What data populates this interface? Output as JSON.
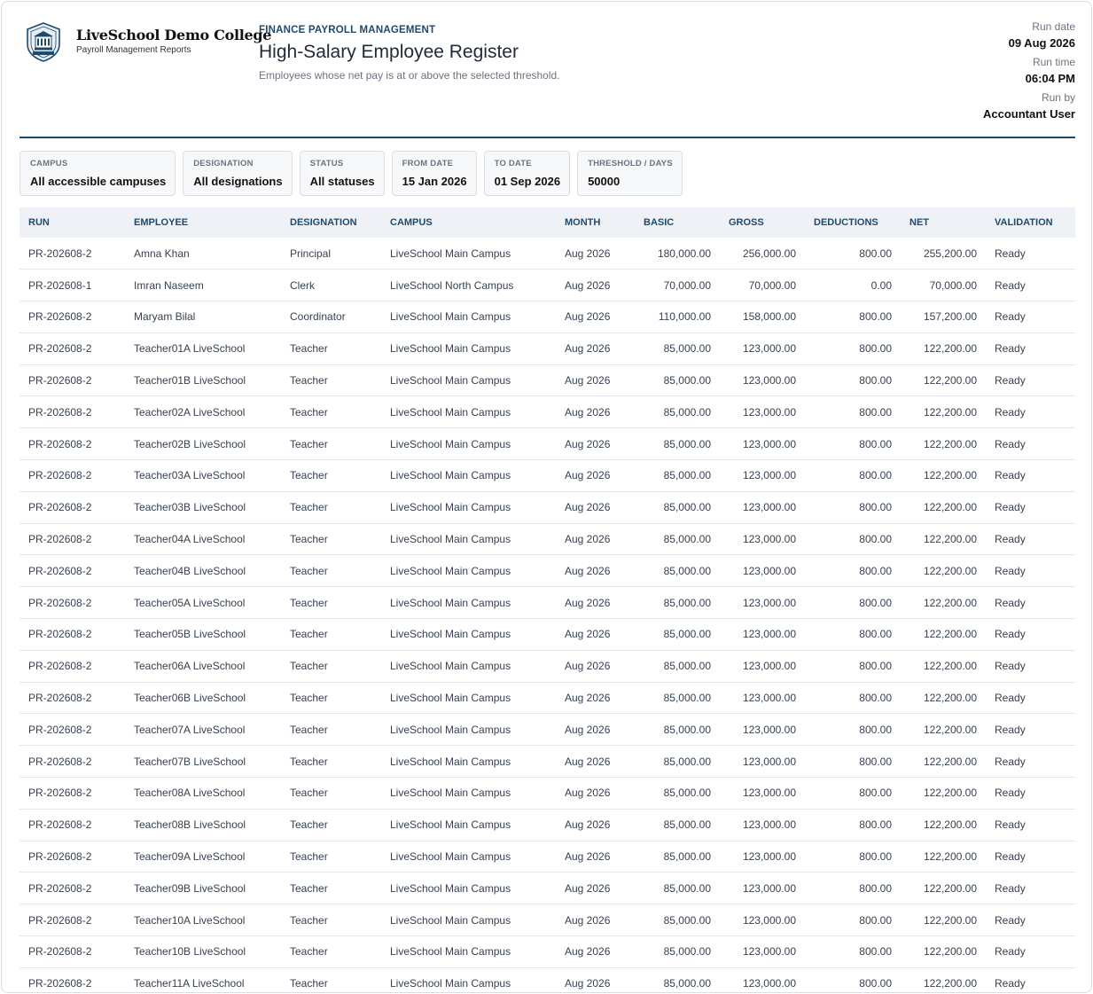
{
  "org": {
    "name": "LiveSchool Demo College",
    "subtitle": "Payroll Management Reports",
    "logo_icon": "school-crest-icon"
  },
  "report": {
    "eyebrow": "FINANCE PAYROLL MANAGEMENT",
    "title": "High-Salary Employee Register",
    "subtitle": "Employees whose net pay is at or above the selected threshold."
  },
  "meta": {
    "run_date_label": "Run date",
    "run_date": "09 Aug 2026",
    "run_time_label": "Run time",
    "run_time": "06:04 PM",
    "run_by_label": "Run by",
    "run_by": "Accountant User"
  },
  "filters": [
    {
      "label": "CAMPUS",
      "value": "All accessible campuses"
    },
    {
      "label": "DESIGNATION",
      "value": "All designations"
    },
    {
      "label": "STATUS",
      "value": "All statuses"
    },
    {
      "label": "FROM DATE",
      "value": "15 Jan 2026"
    },
    {
      "label": "TO DATE",
      "value": "01 Sep 2026"
    },
    {
      "label": "THRESHOLD / DAYS",
      "value": "50000"
    }
  ],
  "columns": [
    "RUN",
    "EMPLOYEE",
    "DESIGNATION",
    "CAMPUS",
    "MONTH",
    "BASIC",
    "GROSS",
    "DEDUCTIONS",
    "NET",
    "VALIDATION"
  ],
  "rows": [
    [
      "PR-202608-2",
      "Amna Khan",
      "Principal",
      "LiveSchool Main Campus",
      "Aug 2026",
      "180,000.00",
      "256,000.00",
      "800.00",
      "255,200.00",
      "Ready"
    ],
    [
      "PR-202608-1",
      "Imran Naseem",
      "Clerk",
      "LiveSchool North Campus",
      "Aug 2026",
      "70,000.00",
      "70,000.00",
      "0.00",
      "70,000.00",
      "Ready"
    ],
    [
      "PR-202608-2",
      "Maryam Bilal",
      "Coordinator",
      "LiveSchool Main Campus",
      "Aug 2026",
      "110,000.00",
      "158,000.00",
      "800.00",
      "157,200.00",
      "Ready"
    ],
    [
      "PR-202608-2",
      "Teacher01A LiveSchool",
      "Teacher",
      "LiveSchool Main Campus",
      "Aug 2026",
      "85,000.00",
      "123,000.00",
      "800.00",
      "122,200.00",
      "Ready"
    ],
    [
      "PR-202608-2",
      "Teacher01B LiveSchool",
      "Teacher",
      "LiveSchool Main Campus",
      "Aug 2026",
      "85,000.00",
      "123,000.00",
      "800.00",
      "122,200.00",
      "Ready"
    ],
    [
      "PR-202608-2",
      "Teacher02A LiveSchool",
      "Teacher",
      "LiveSchool Main Campus",
      "Aug 2026",
      "85,000.00",
      "123,000.00",
      "800.00",
      "122,200.00",
      "Ready"
    ],
    [
      "PR-202608-2",
      "Teacher02B LiveSchool",
      "Teacher",
      "LiveSchool Main Campus",
      "Aug 2026",
      "85,000.00",
      "123,000.00",
      "800.00",
      "122,200.00",
      "Ready"
    ],
    [
      "PR-202608-2",
      "Teacher03A LiveSchool",
      "Teacher",
      "LiveSchool Main Campus",
      "Aug 2026",
      "85,000.00",
      "123,000.00",
      "800.00",
      "122,200.00",
      "Ready"
    ],
    [
      "PR-202608-2",
      "Teacher03B LiveSchool",
      "Teacher",
      "LiveSchool Main Campus",
      "Aug 2026",
      "85,000.00",
      "123,000.00",
      "800.00",
      "122,200.00",
      "Ready"
    ],
    [
      "PR-202608-2",
      "Teacher04A LiveSchool",
      "Teacher",
      "LiveSchool Main Campus",
      "Aug 2026",
      "85,000.00",
      "123,000.00",
      "800.00",
      "122,200.00",
      "Ready"
    ],
    [
      "PR-202608-2",
      "Teacher04B LiveSchool",
      "Teacher",
      "LiveSchool Main Campus",
      "Aug 2026",
      "85,000.00",
      "123,000.00",
      "800.00",
      "122,200.00",
      "Ready"
    ],
    [
      "PR-202608-2",
      "Teacher05A LiveSchool",
      "Teacher",
      "LiveSchool Main Campus",
      "Aug 2026",
      "85,000.00",
      "123,000.00",
      "800.00",
      "122,200.00",
      "Ready"
    ],
    [
      "PR-202608-2",
      "Teacher05B LiveSchool",
      "Teacher",
      "LiveSchool Main Campus",
      "Aug 2026",
      "85,000.00",
      "123,000.00",
      "800.00",
      "122,200.00",
      "Ready"
    ],
    [
      "PR-202608-2",
      "Teacher06A LiveSchool",
      "Teacher",
      "LiveSchool Main Campus",
      "Aug 2026",
      "85,000.00",
      "123,000.00",
      "800.00",
      "122,200.00",
      "Ready"
    ],
    [
      "PR-202608-2",
      "Teacher06B LiveSchool",
      "Teacher",
      "LiveSchool Main Campus",
      "Aug 2026",
      "85,000.00",
      "123,000.00",
      "800.00",
      "122,200.00",
      "Ready"
    ],
    [
      "PR-202608-2",
      "Teacher07A LiveSchool",
      "Teacher",
      "LiveSchool Main Campus",
      "Aug 2026",
      "85,000.00",
      "123,000.00",
      "800.00",
      "122,200.00",
      "Ready"
    ],
    [
      "PR-202608-2",
      "Teacher07B LiveSchool",
      "Teacher",
      "LiveSchool Main Campus",
      "Aug 2026",
      "85,000.00",
      "123,000.00",
      "800.00",
      "122,200.00",
      "Ready"
    ],
    [
      "PR-202608-2",
      "Teacher08A LiveSchool",
      "Teacher",
      "LiveSchool Main Campus",
      "Aug 2026",
      "85,000.00",
      "123,000.00",
      "800.00",
      "122,200.00",
      "Ready"
    ],
    [
      "PR-202608-2",
      "Teacher08B LiveSchool",
      "Teacher",
      "LiveSchool Main Campus",
      "Aug 2026",
      "85,000.00",
      "123,000.00",
      "800.00",
      "122,200.00",
      "Ready"
    ],
    [
      "PR-202608-2",
      "Teacher09A LiveSchool",
      "Teacher",
      "LiveSchool Main Campus",
      "Aug 2026",
      "85,000.00",
      "123,000.00",
      "800.00",
      "122,200.00",
      "Ready"
    ],
    [
      "PR-202608-2",
      "Teacher09B LiveSchool",
      "Teacher",
      "LiveSchool Main Campus",
      "Aug 2026",
      "85,000.00",
      "123,000.00",
      "800.00",
      "122,200.00",
      "Ready"
    ],
    [
      "PR-202608-2",
      "Teacher10A LiveSchool",
      "Teacher",
      "LiveSchool Main Campus",
      "Aug 2026",
      "85,000.00",
      "123,000.00",
      "800.00",
      "122,200.00",
      "Ready"
    ],
    [
      "PR-202608-2",
      "Teacher10B LiveSchool",
      "Teacher",
      "LiveSchool Main Campus",
      "Aug 2026",
      "85,000.00",
      "123,000.00",
      "800.00",
      "122,200.00",
      "Ready"
    ],
    [
      "PR-202608-2",
      "Teacher11A LiveSchool",
      "Teacher",
      "LiveSchool Main Campus",
      "Aug 2026",
      "85,000.00",
      "123,000.00",
      "800.00",
      "122,200.00",
      "Ready"
    ]
  ],
  "colors": {
    "accent": "#1e4a6e",
    "header_bg": "#eef2f6",
    "filter_bg": "#f7f8fa",
    "border": "#d9dde3"
  }
}
